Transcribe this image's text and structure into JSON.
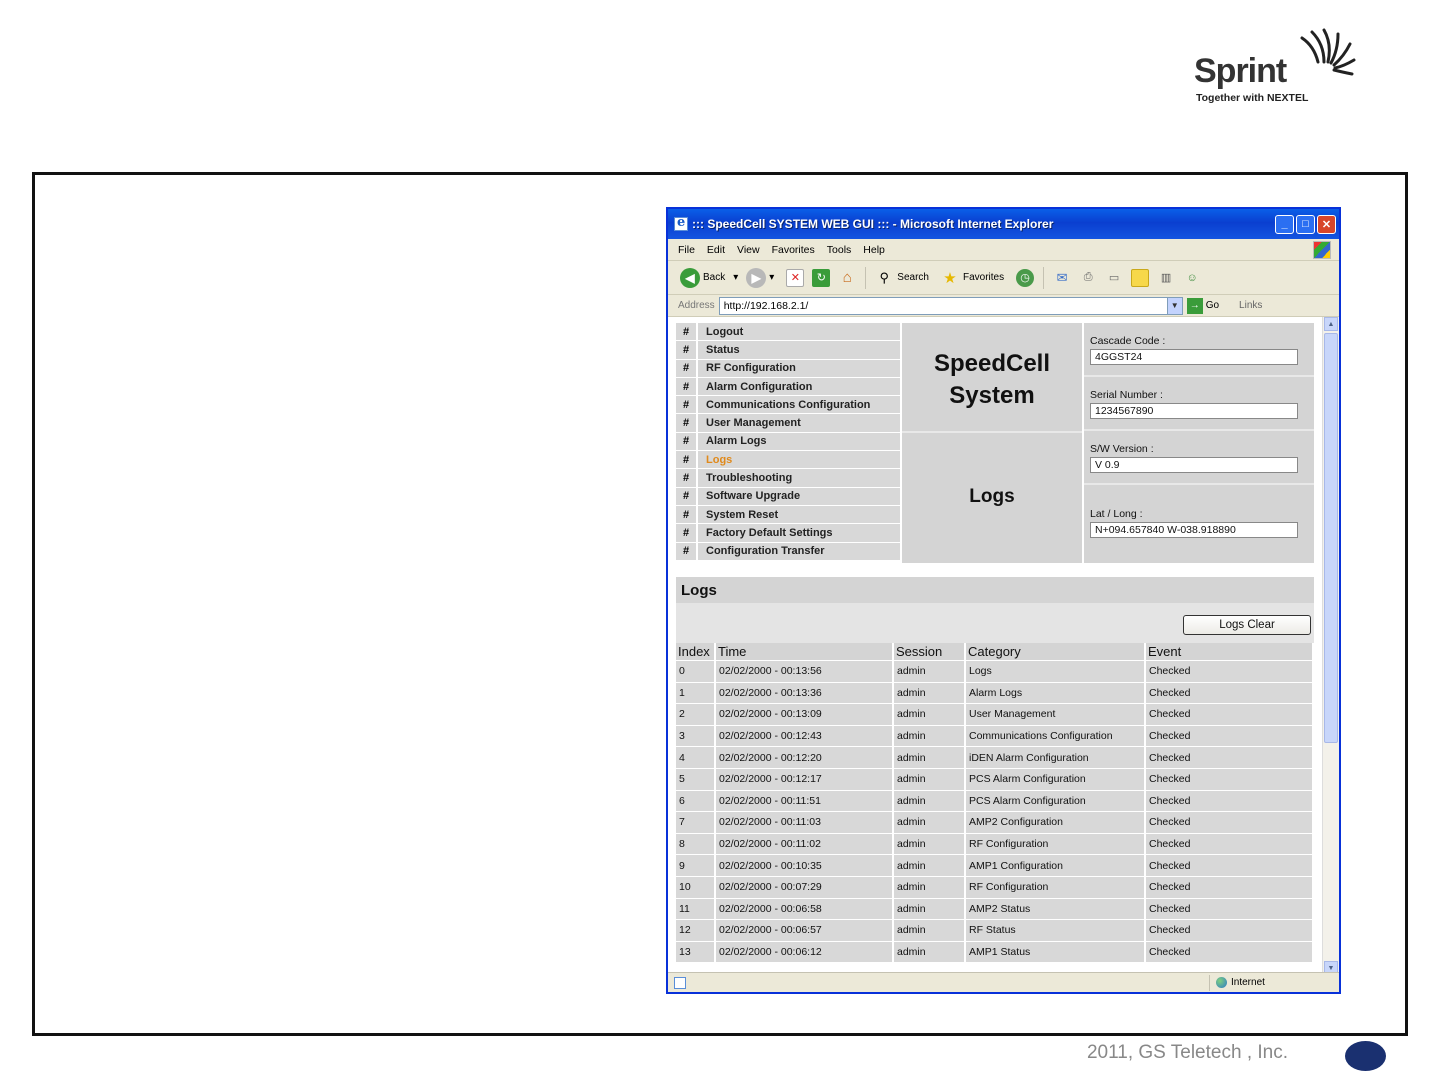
{
  "logo": {
    "word": "Sprint",
    "tagline": "Together with NEXTEL"
  },
  "window": {
    "title": "::: SpeedCell SYSTEM WEB GUI ::: - Microsoft Internet Explorer",
    "buttons": {
      "minimize": "_",
      "maximize": "□",
      "close": "✕"
    }
  },
  "menu": [
    "File",
    "Edit",
    "View",
    "Favorites",
    "Tools",
    "Help"
  ],
  "toolbar": {
    "back": "Back",
    "search": "Search",
    "favorites": "Favorites"
  },
  "address": {
    "label": "Address",
    "url": "http://192.168.2.1/",
    "go": "Go",
    "links": "Links"
  },
  "nav": {
    "hash": "#",
    "items": [
      "Logout",
      "Status",
      "RF Configuration",
      "Alarm Configuration",
      "Communications Configuration",
      "User Management",
      "Alarm Logs",
      "Logs",
      "Troubleshooting",
      "Software Upgrade",
      "System Reset",
      "Factory Default Settings",
      "Configuration Transfer"
    ],
    "active_index": 7
  },
  "brand": {
    "line1": "SpeedCell",
    "line2": "System",
    "section": "Logs"
  },
  "info": {
    "cascade_label": "Cascade Code :",
    "cascade_value": "4GGST24",
    "serial_label": "Serial Number :",
    "serial_value": "1234567890",
    "sw_label": "S/W Version :",
    "sw_value": "V 0.9",
    "latlong_label": "Lat / Long :",
    "latlong_value": "N+094.657840 W-038.918890"
  },
  "logs": {
    "heading": "Logs",
    "clear_button": "Logs Clear",
    "columns": [
      "Index",
      "Time",
      "Session",
      "Category",
      "Event"
    ],
    "rows": [
      [
        "0",
        "02/02/2000 - 00:13:56",
        "admin",
        "Logs",
        "Checked"
      ],
      [
        "1",
        "02/02/2000 - 00:13:36",
        "admin",
        "Alarm Logs",
        "Checked"
      ],
      [
        "2",
        "02/02/2000 - 00:13:09",
        "admin",
        "User Management",
        "Checked"
      ],
      [
        "3",
        "02/02/2000 - 00:12:43",
        "admin",
        "Communications Configuration",
        "Checked"
      ],
      [
        "4",
        "02/02/2000 - 00:12:20",
        "admin",
        "iDEN Alarm Configuration",
        "Checked"
      ],
      [
        "5",
        "02/02/2000 - 00:12:17",
        "admin",
        "PCS Alarm Configuration",
        "Checked"
      ],
      [
        "6",
        "02/02/2000 - 00:11:51",
        "admin",
        "PCS Alarm Configuration",
        "Checked"
      ],
      [
        "7",
        "02/02/2000 - 00:11:03",
        "admin",
        "AMP2 Configuration",
        "Checked"
      ],
      [
        "8",
        "02/02/2000 - 00:11:02",
        "admin",
        "RF Configuration",
        "Checked"
      ],
      [
        "9",
        "02/02/2000 - 00:10:35",
        "admin",
        "AMP1 Configuration",
        "Checked"
      ],
      [
        "10",
        "02/02/2000 - 00:07:29",
        "admin",
        "RF Configuration",
        "Checked"
      ],
      [
        "11",
        "02/02/2000 - 00:06:58",
        "admin",
        "AMP2 Status",
        "Checked"
      ],
      [
        "12",
        "02/02/2000 - 00:06:57",
        "admin",
        "RF Status",
        "Checked"
      ],
      [
        "13",
        "02/02/2000 - 00:06:12",
        "admin",
        "AMP1 Status",
        "Checked"
      ]
    ]
  },
  "statusbar": {
    "zone": "Internet"
  },
  "footer": {
    "copyright": "2011, GS Teletech , Inc."
  },
  "colors": {
    "titlebar": "#0a5fe8",
    "active_nav": "#e08a1c",
    "page_badge": "#1a3070"
  }
}
